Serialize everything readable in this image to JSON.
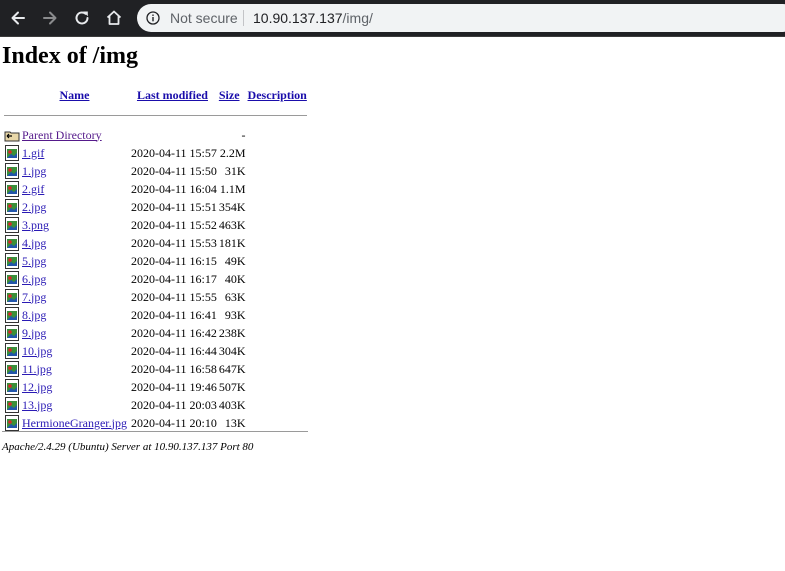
{
  "browser": {
    "security_label": "Not secure",
    "url_host": "10.90.137.137",
    "url_path": "/img/"
  },
  "page": {
    "title": "Index of /img",
    "columns": {
      "name": "Name",
      "last_modified": "Last modified",
      "size": "Size",
      "description": "Description"
    },
    "parent": {
      "label": "Parent Directory",
      "size": "-"
    },
    "files": [
      {
        "name": "1.gif",
        "modified": "2020-04-11 15:57",
        "size": "2.2M"
      },
      {
        "name": "1.jpg",
        "modified": "2020-04-11 15:50",
        "size": "31K"
      },
      {
        "name": "2.gif",
        "modified": "2020-04-11 16:04",
        "size": "1.1M"
      },
      {
        "name": "2.jpg",
        "modified": "2020-04-11 15:51",
        "size": "354K"
      },
      {
        "name": "3.png",
        "modified": "2020-04-11 15:52",
        "size": "463K"
      },
      {
        "name": "4.jpg",
        "modified": "2020-04-11 15:53",
        "size": "181K"
      },
      {
        "name": "5.jpg",
        "modified": "2020-04-11 16:15",
        "size": "49K"
      },
      {
        "name": "6.jpg",
        "modified": "2020-04-11 16:17",
        "size": "40K"
      },
      {
        "name": "7.jpg",
        "modified": "2020-04-11 15:55",
        "size": "63K"
      },
      {
        "name": "8.jpg",
        "modified": "2020-04-11 16:41",
        "size": "93K"
      },
      {
        "name": "9.jpg",
        "modified": "2020-04-11 16:42",
        "size": "238K"
      },
      {
        "name": "10.jpg",
        "modified": "2020-04-11 16:44",
        "size": "304K"
      },
      {
        "name": "11.jpg",
        "modified": "2020-04-11 16:58",
        "size": "647K"
      },
      {
        "name": "12.jpg",
        "modified": "2020-04-11 19:46",
        "size": "507K"
      },
      {
        "name": "13.jpg",
        "modified": "2020-04-11 20:03",
        "size": "403K"
      },
      {
        "name": "HermioneGranger.jpg",
        "modified": "2020-04-11 20:10",
        "size": "13K"
      }
    ],
    "footer": "Apache/2.4.29 (Ubuntu) Server at 10.90.137.137 Port 80"
  }
}
